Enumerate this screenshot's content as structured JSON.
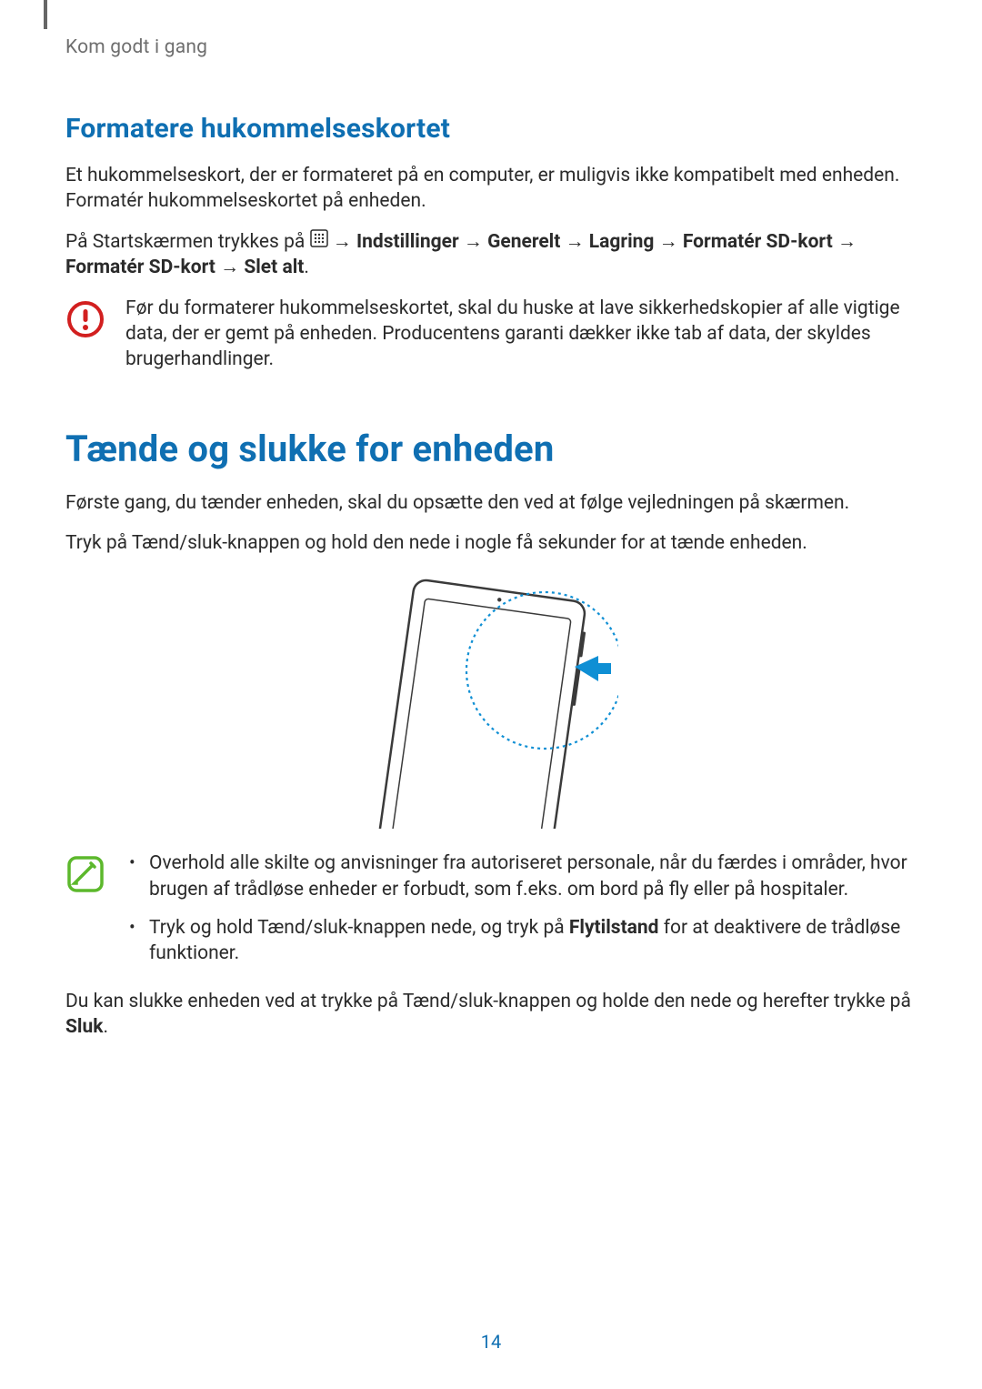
{
  "header": {
    "chapter": "Kom godt i gang"
  },
  "section1": {
    "heading": "Formatere hukommelseskortet",
    "p1": "Et hukommelseskort, der er formateret på en computer, er muligvis ikke kompatibelt med enheden. Formatér hukommelseskortet på enheden.",
    "p2_prefix": "På Startskærmen trykkes på ",
    "p2_arrow": " → ",
    "p2_b1": "Indstillinger",
    "p2_b2": "Generelt",
    "p2_b3": "Lagring",
    "p2_b4": "Formatér SD-kort",
    "p2_b5": "Formatér SD-kort",
    "p2_b6": "Slet alt",
    "p2_period": ".",
    "caution_text": "Før du formaterer hukommelseskortet, skal du huske at lave sikkerhedskopier af alle vigtige data, der er gemt på enheden. Producentens garanti dækker ikke tab af data, der skyldes brugerhandlinger."
  },
  "section2": {
    "heading": "Tænde og slukke for enheden",
    "p1": "Første gang, du tænder enheden, skal du opsætte den ved at følge vejledningen på skærmen.",
    "p2": "Tryk på Tænd/sluk-knappen og hold den nede i nogle få sekunder for at tænde enheden.",
    "note_li1": "Overhold alle skilte og anvisninger fra autoriseret personale, når du færdes i områder, hvor brugen af trådløse enheder er forbudt, som f.eks. om bord på fly eller på hospitaler.",
    "note_li2_a": "Tryk og hold Tænd/sluk-knappen nede, og tryk på ",
    "note_li2_bold": "Flytilstand",
    "note_li2_b": " for at deaktivere de trådløse funktioner.",
    "p3_a": "Du kan slukke enheden ved at trykke på Tænd/sluk-knappen og holde den nede og herefter trykke på ",
    "p3_bold": "Sluk",
    "p3_b": "."
  },
  "page_number": "14"
}
